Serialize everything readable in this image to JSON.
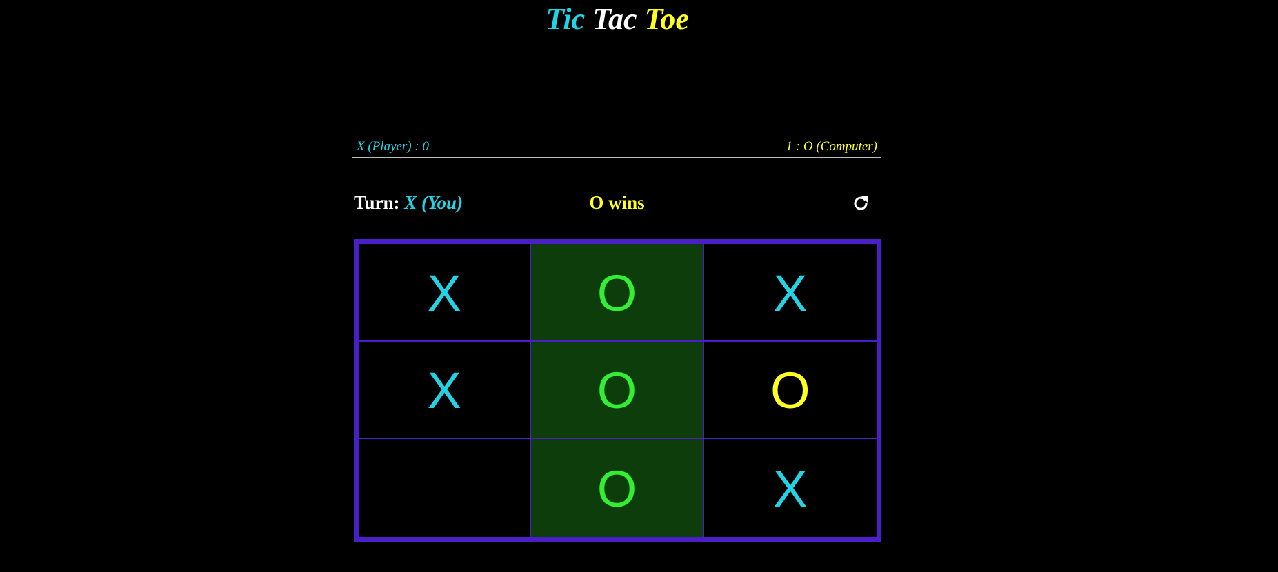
{
  "title": {
    "word1": "Tic",
    "word2": "Tac",
    "word3": "Toe"
  },
  "score": {
    "player_label": "X (Player) : 0",
    "computer_label": "1 : O (Computer)"
  },
  "turn": {
    "label": "Turn:",
    "value": "X (You)"
  },
  "status": "O wins",
  "board": {
    "cells": [
      "X",
      "O",
      "X",
      "X",
      "O",
      "O",
      "",
      "O",
      "X"
    ],
    "winning_cells": [
      1,
      4,
      7
    ]
  },
  "colors": {
    "x": "#22d3e6",
    "o": "#ffff22",
    "win_mark": "#33ee33",
    "win_bg": "#0c3d0a",
    "grid": "#4a1fc8",
    "background": "#000000"
  },
  "icons": {
    "restart": "restart-icon"
  }
}
